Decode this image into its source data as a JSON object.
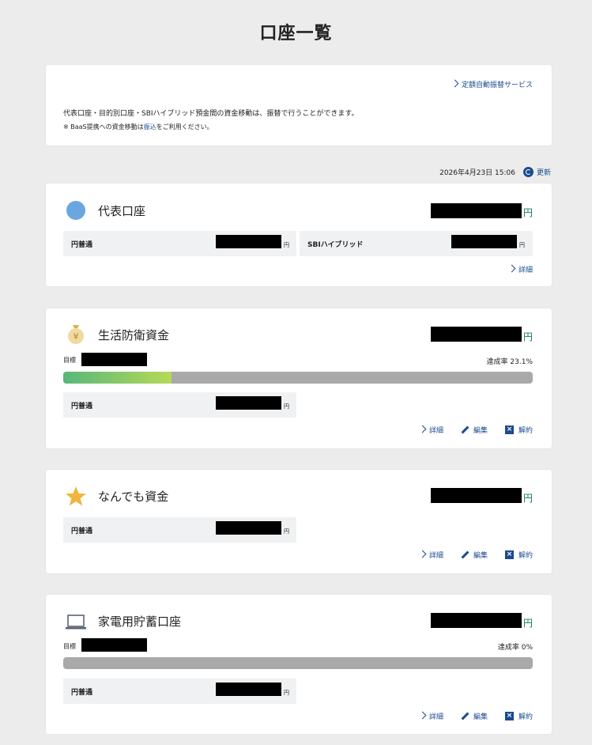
{
  "page": {
    "title": "口座一覧"
  },
  "info": {
    "service_link": "定額自動振替サービス",
    "text1": "代表口座・目的別口座・SBIハイブリッド預金間の資金移動は、振替で行うことができます。",
    "text2_prefix": "※ BaaS提携への資金移動は",
    "text2_link": "振込",
    "text2_suffix": "をご利用ください。"
  },
  "update": {
    "timestamp": "2026年4月23日 15:06",
    "label": "更新"
  },
  "yen": "円",
  "accounts": [
    {
      "name": "代表口座",
      "icon": "blue-circle-icon",
      "sub": [
        {
          "label": "円普通"
        },
        {
          "label": "SBIハイブリッド"
        }
      ],
      "actions": {
        "detail": "詳細"
      }
    },
    {
      "name": "生活防衛資金",
      "icon": "money-bag-icon",
      "goal_label": "目標",
      "rate": "達成率 23.1%",
      "progress": 0.231,
      "sub": [
        {
          "label": "円普通"
        }
      ],
      "actions": {
        "detail": "詳細",
        "edit": "編集",
        "cancel": "解約"
      }
    },
    {
      "name": "なんでも資金",
      "icon": "star-icon",
      "sub": [
        {
          "label": "円普通"
        }
      ],
      "actions": {
        "detail": "詳細",
        "edit": "編集",
        "cancel": "解約"
      }
    },
    {
      "name": "家電用貯蓄口座",
      "icon": "laptop-icon",
      "goal_label": "目標",
      "rate": "達成率 0%",
      "progress": 0,
      "sub": [
        {
          "label": "円普通"
        }
      ],
      "actions": {
        "detail": "詳細",
        "edit": "編集",
        "cancel": "解約"
      }
    }
  ]
}
